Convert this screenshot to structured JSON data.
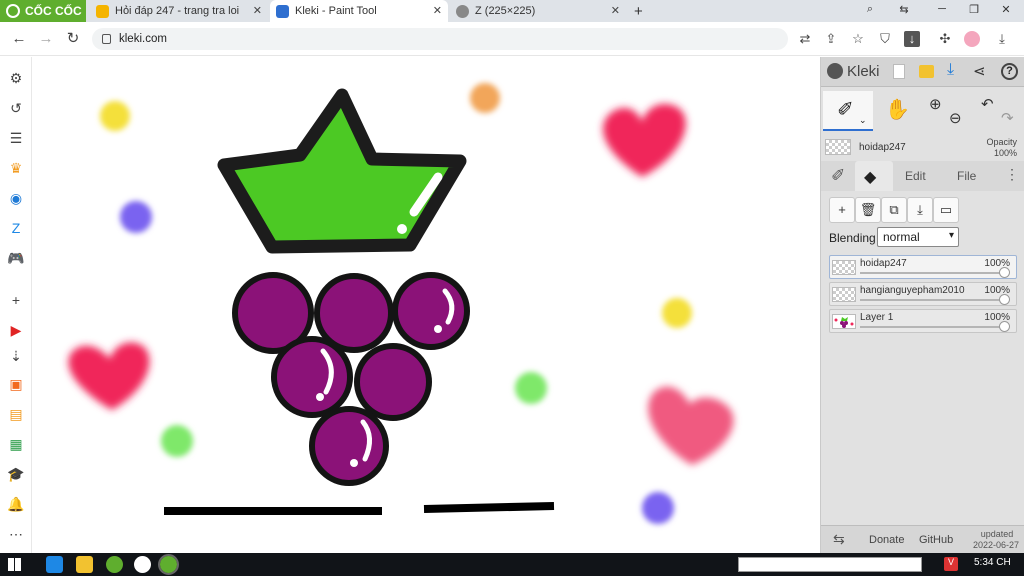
{
  "browser": {
    "brand": "CỐC CỐC",
    "tabs": [
      {
        "label": "Hỏi đáp 247 - trang tra loi",
        "close": "✕"
      },
      {
        "label": "Kleki - Paint Tool",
        "close": "✕"
      },
      {
        "label": "Z (225×225)",
        "close": "✕"
      },
      {
        "label": "+"
      }
    ],
    "address": "kleki.com",
    "window_buttons": [
      "─",
      "❐",
      "✕"
    ]
  },
  "sidebar": {
    "icons": [
      "gear-icon",
      "history-icon",
      "list-icon",
      "crown-icon",
      "messenger-icon",
      "zalo-icon",
      "gamepad-icon",
      "plus-icon",
      "youtube-icon",
      "download-icon",
      "app-77-icon",
      "app-m-icon",
      "sheet-icon",
      "grad-cap-icon",
      "bell-icon",
      "more-icon"
    ]
  },
  "kleki": {
    "logo": "Kleki",
    "brush_layer_name": "hoidap247",
    "opacity_label": "Opacity",
    "opacity_value": "100%",
    "tabs": {
      "edit": "Edit",
      "file": "File"
    },
    "blending_label": "Blending",
    "blending_value": "normal",
    "layers": [
      {
        "name": "hoidap247",
        "opacity": "100%",
        "opacity_fraction": 1.0
      },
      {
        "name": "hangianguyepham2010",
        "opacity": "100%",
        "opacity_fraction": 1.0
      },
      {
        "name": "Layer 1",
        "opacity": "100%",
        "opacity_fraction": 1.0
      }
    ],
    "footer": {
      "donate": "Donate",
      "github": "GitHub",
      "updated_label": "updated",
      "updated_date": "2022-06-27"
    }
  },
  "taskbar": {
    "clock": "5:34 CH"
  },
  "colors": {
    "crown_green": "#4cc924",
    "grape_purple": "#8b1278",
    "heart_pink": "#f0285a",
    "outline": "#1c1c1c",
    "brand_green": "#5fae2e"
  }
}
